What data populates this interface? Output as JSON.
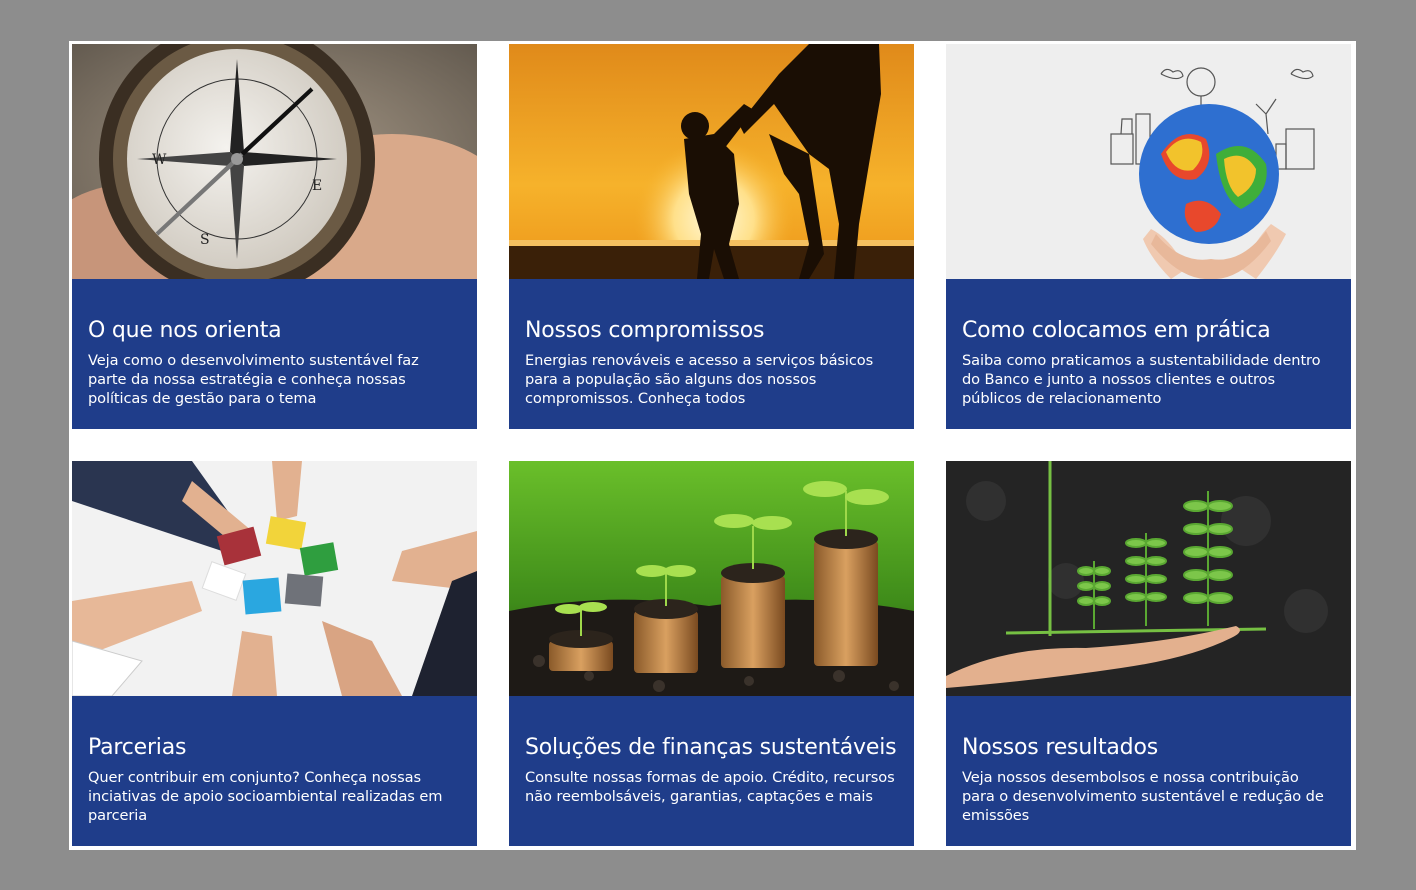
{
  "colors": {
    "page_background": "#8d8d8d",
    "frame_background": "#ffffff",
    "card_background": "#1f3d8a",
    "card_text": "#ffffff"
  },
  "cards": [
    {
      "title": "O que nos orienta",
      "description": "Veja como o desenvolvimento sustentável faz parte da nossa estratégia e conheça nossas políticas de gestão para o tema",
      "image_icon": "compass-photo"
    },
    {
      "title": "Nossos compromissos",
      "description": "Energias renováveis e acesso a serviços básicos para a população são alguns dos nossos compromissos. Conheça todos",
      "image_icon": "sunset-family-photo"
    },
    {
      "title": "Como colocamos em prática",
      "description": "Saiba como praticamos a sustentabilidade dentro do Banco e junto a nossos clientes e outros públicos de relacionamento",
      "image_icon": "globe-hands-photo"
    },
    {
      "title": "Parcerias",
      "description": "Quer contribuir em conjunto? Conheça nossas inciativas de apoio socioambiental realizadas em parceria",
      "image_icon": "puzzle-hands-photo"
    },
    {
      "title": "Soluções de finanças sustentáveis",
      "description": "Consulte nossas formas de apoio. Crédito, recursos não reembolsáveis, garantias, captações e mais",
      "image_icon": "coins-sprouts-photo"
    },
    {
      "title": "Nossos resultados",
      "description": "Veja nossos desembolsos e nossa contribuição para o desenvolvimento sustentável e redução de emissões",
      "image_icon": "plant-growth-chart-photo"
    }
  ]
}
